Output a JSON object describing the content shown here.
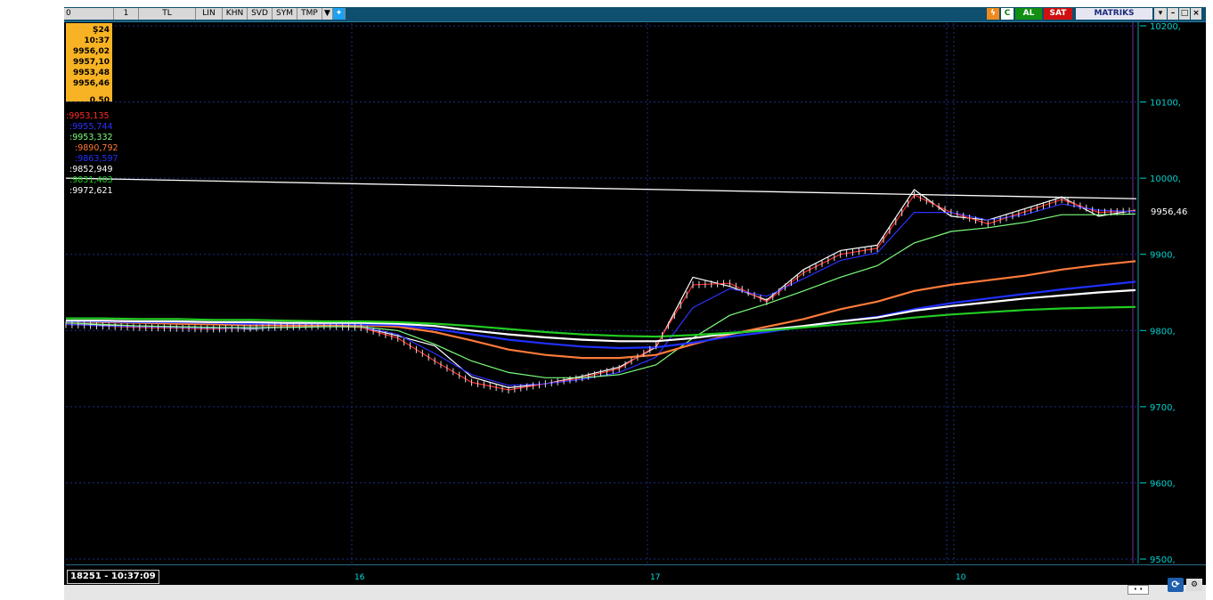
{
  "toolbar": {
    "buttons": [
      "0",
      "1",
      "TL",
      "LIN",
      "KHN",
      "SVD",
      "SYM",
      "TMP"
    ],
    "buy_label": "AL",
    "sell_label": "SAT",
    "brand": "MATRIKS"
  },
  "info_box": {
    "datetime": "Ş24 10:37",
    "values": [
      "9956,02",
      "9957,10",
      "9953,48",
      "9956,46"
    ],
    "change": "0,50"
  },
  "ma_values": [
    {
      "text": ":9953,135",
      "color": "#ff2a2a"
    },
    {
      "text": ":9955,744",
      "color": "#3030ff"
    },
    {
      "text": ":9953,332",
      "color": "#7cff7c"
    },
    {
      "text": ":9890,792",
      "color": "#ff7a3a"
    },
    {
      "text": ":9863,597",
      "color": "#2030ff"
    },
    {
      "text": ":9852,949",
      "color": "#ffffff"
    },
    {
      "text": ":9831,403",
      "color": "#22cc22"
    },
    {
      "text": ":9972,621",
      "color": "#ffffff"
    }
  ],
  "cursor_readout": "18251 - 10:37:09",
  "x_labels": [
    "16",
    "17",
    "10"
  ],
  "price_tag": "9956,46",
  "chart_data": {
    "type": "line",
    "ylim": [
      9500,
      10200
    ],
    "y_ticks": [
      "10200,",
      "10100,",
      "10000,",
      "9900,",
      "9800,",
      "9700,",
      "9600,",
      "9500,"
    ],
    "x": [
      0,
      10,
      20,
      30,
      40,
      50,
      60,
      70,
      80,
      90,
      100,
      110,
      120,
      130,
      140,
      150,
      160,
      170,
      180,
      190,
      200
    ],
    "series": [
      {
        "color": "#ffffff",
        "values": [
          9808,
          9807,
          9806,
          9805,
          9804,
          9802,
          9805,
          9806,
          9805,
          9793,
          9780,
          9739,
          9725,
          9730,
          9740,
          9752,
          9778,
          9870,
          9858,
          9840,
          9880,
          9905,
          9912,
          9985,
          9950,
          9945,
          9960,
          9975,
          9950,
          9958
        ]
      },
      {
        "color": "#ff2a2a",
        "values": [
          9808,
          9806,
          9804,
          9803,
          9802,
          9803,
          9805,
          9806,
          9804,
          9790,
          9760,
          9732,
          9722,
          9730,
          9738,
          9750,
          9780,
          9860,
          9862,
          9838,
          9876,
          9900,
          9908,
          9978,
          9955,
          9940,
          9956,
          9972,
          9955,
          9957
        ]
      },
      {
        "color": "#3030ff",
        "values": [
          9808,
          9806,
          9805,
          9804,
          9803,
          9803,
          9804,
          9805,
          9805,
          9795,
          9770,
          9742,
          9728,
          9730,
          9736,
          9745,
          9765,
          9830,
          9855,
          9845,
          9868,
          9892,
          9902,
          9955,
          9955,
          9945,
          9952,
          9966,
          9958,
          9956
        ]
      },
      {
        "color": "#7cff7c",
        "values": [
          9810,
          9808,
          9806,
          9805,
          9804,
          9804,
          9804,
          9805,
          9805,
          9800,
          9782,
          9760,
          9745,
          9738,
          9738,
          9742,
          9755,
          9790,
          9820,
          9835,
          9852,
          9870,
          9885,
          9915,
          9930,
          9935,
          9942,
          9952,
          9952,
          9953
        ]
      },
      {
        "color": "#ff7a3a",
        "values": [
          9812,
          9811,
          9810,
          9809,
          9808,
          9807,
          9807,
          9807,
          9807,
          9805,
          9798,
          9787,
          9775,
          9768,
          9764,
          9764,
          9768,
          9782,
          9795,
          9805,
          9815,
          9828,
          9838,
          9852,
          9860,
          9866,
          9872,
          9880,
          9886,
          9891
        ]
      },
      {
        "color": "#2030ff",
        "values": [
          9812,
          9812,
          9811,
          9811,
          9810,
          9809,
          9809,
          9809,
          9808,
          9807,
          9802,
          9795,
          9788,
          9783,
          9779,
          9777,
          9778,
          9784,
          9792,
          9798,
          9805,
          9812,
          9818,
          9828,
          9836,
          9842,
          9848,
          9854,
          9859,
          9864
        ]
      },
      {
        "color": "#ffffff",
        "values": [
          9813,
          9813,
          9812,
          9812,
          9811,
          9811,
          9810,
          9810,
          9810,
          9809,
          9806,
          9800,
          9795,
          9791,
          9788,
          9786,
          9786,
          9790,
          9796,
          9801,
          9806,
          9812,
          9817,
          9826,
          9832,
          9837,
          9842,
          9846,
          9850,
          9853
        ]
      },
      {
        "color": "#22cc22",
        "values": [
          9816,
          9816,
          9815,
          9815,
          9814,
          9814,
          9813,
          9812,
          9812,
          9811,
          9809,
          9806,
          9802,
          9798,
          9795,
          9793,
          9792,
          9794,
          9797,
          9800,
          9804,
          9808,
          9812,
          9817,
          9821,
          9824,
          9827,
          9829,
          9830,
          9831
        ]
      }
    ],
    "trendline": {
      "color": "#ffffff",
      "values": [
        10000,
        9973
      ]
    },
    "grid": true
  }
}
